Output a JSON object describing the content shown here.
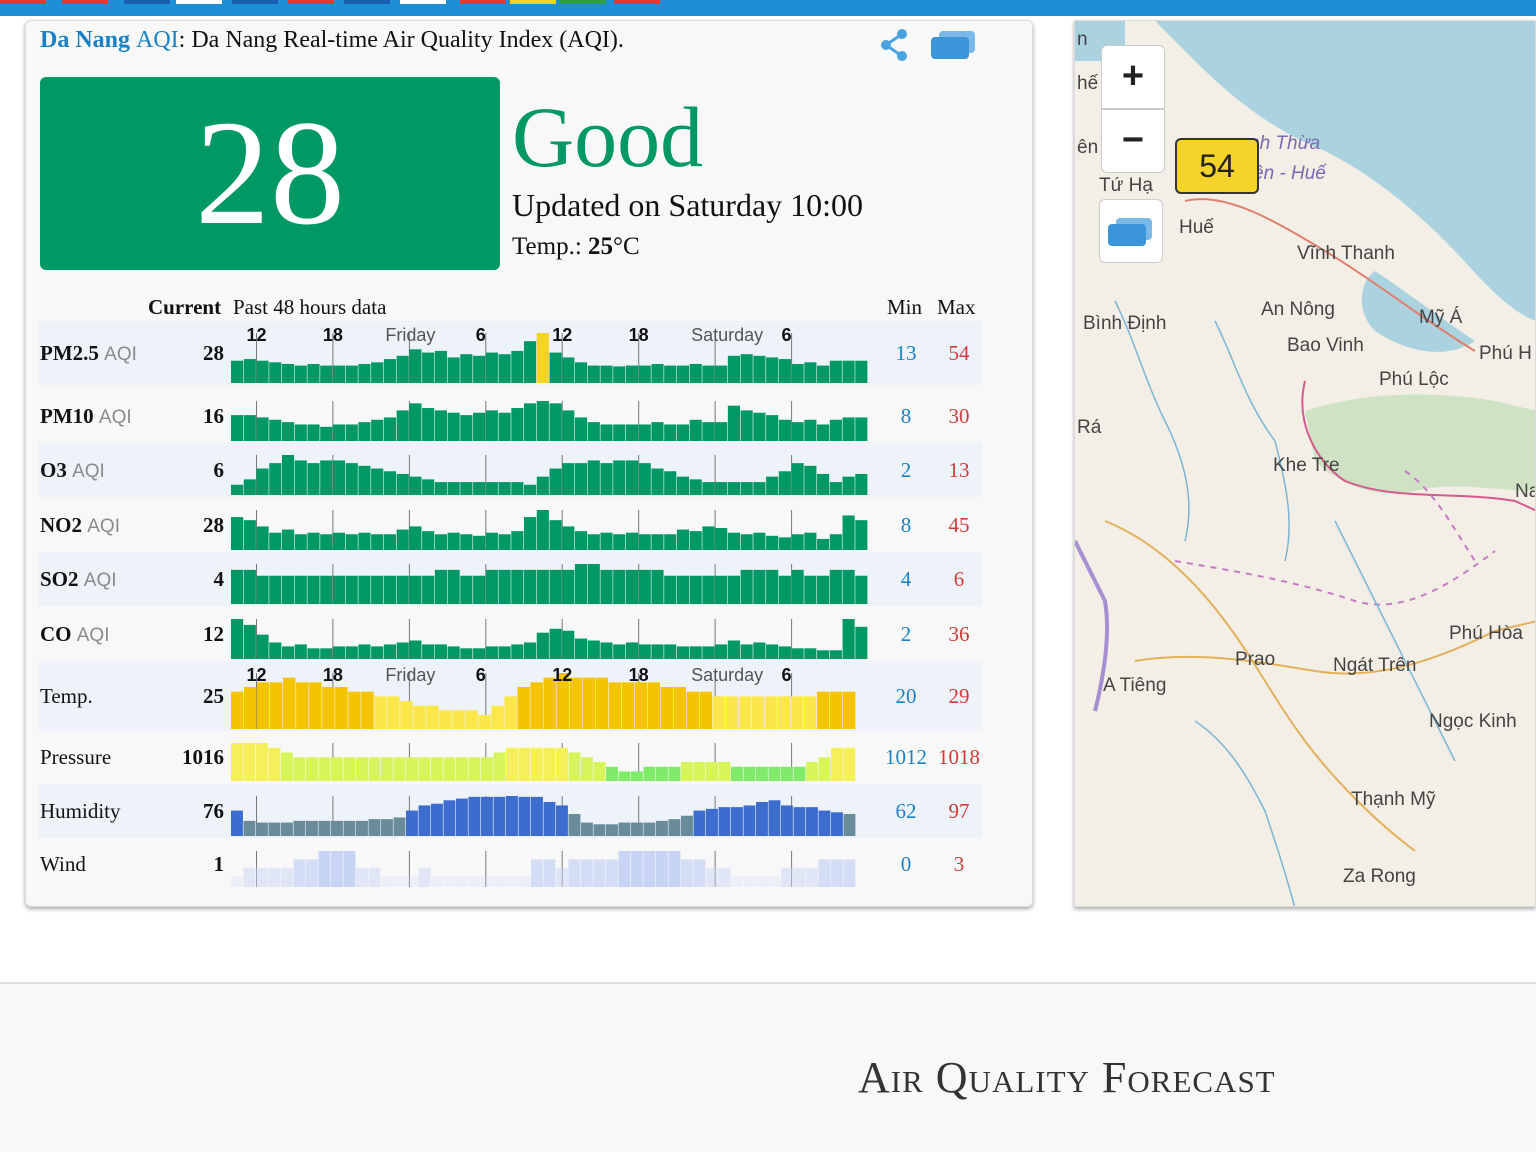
{
  "headline": {
    "city_link_bold": "Da Nang",
    "city_link_thin": "AQI",
    "description": ": Da Nang Real-time Air Quality Index (AQI)."
  },
  "aqi": {
    "value": "28",
    "level": "Good",
    "updated": "Updated on Saturday 10:00",
    "temp_label": "Temp.: ",
    "temp_value": "25",
    "temp_unit": "°C",
    "color": "#009966"
  },
  "table": {
    "current_label": "Current",
    "past_label": "Past 48 hours data",
    "min_label": "Min",
    "max_label": "Max",
    "axis_labels": [
      {
        "text": "12",
        "kind": "hr",
        "hour_index": 2
      },
      {
        "text": "18",
        "kind": "hr",
        "hour_index": 8
      },
      {
        "text": "Friday",
        "kind": "day",
        "hour_index": 14
      },
      {
        "text": "6",
        "kind": "hr",
        "hour_index": 20
      },
      {
        "text": "12",
        "kind": "hr",
        "hour_index": 26
      },
      {
        "text": "18",
        "kind": "hr",
        "hour_index": 32
      },
      {
        "text": "Saturday",
        "kind": "day",
        "hour_index": 38
      },
      {
        "text": "6",
        "kind": "hr",
        "hour_index": 44
      }
    ],
    "rows": [
      {
        "id": "pm25",
        "name": "PM2.5",
        "suffix": "AQI",
        "current": "28",
        "min": "13",
        "max": "54",
        "color": "#009966",
        "highlight_index": 24,
        "highlight_color": "#f5d328",
        "values": [
          20,
          22,
          20,
          18,
          16,
          14,
          16,
          14,
          14,
          14,
          16,
          18,
          22,
          26,
          34,
          30,
          32,
          24,
          28,
          26,
          30,
          28,
          32,
          44,
          54,
          30,
          24,
          18,
          14,
          14,
          13,
          14,
          14,
          16,
          14,
          14,
          16,
          14,
          14,
          26,
          28,
          26,
          24,
          22,
          16,
          18,
          14,
          20,
          20,
          20
        ]
      },
      {
        "id": "pm10",
        "name": "PM10",
        "suffix": "AQI",
        "current": "16",
        "min": "8",
        "max": "30",
        "color": "#009966",
        "values": [
          18,
          18,
          16,
          14,
          12,
          10,
          10,
          8,
          10,
          10,
          12,
          14,
          16,
          22,
          28,
          24,
          22,
          20,
          18,
          20,
          22,
          20,
          24,
          28,
          30,
          28,
          22,
          16,
          12,
          10,
          10,
          10,
          10,
          12,
          10,
          10,
          14,
          12,
          12,
          26,
          22,
          20,
          18,
          14,
          12,
          14,
          10,
          14,
          16,
          16
        ]
      },
      {
        "id": "o3",
        "name": "O3",
        "suffix": "AQI",
        "current": "6",
        "min": "2",
        "max": "13",
        "color": "#009966",
        "values": [
          2,
          4,
          8,
          10,
          13,
          11,
          10,
          11,
          11,
          10,
          9,
          8,
          7,
          6,
          5,
          4,
          3,
          3,
          3,
          3,
          3,
          3,
          3,
          2,
          5,
          8,
          10,
          10,
          11,
          10,
          11,
          11,
          10,
          8,
          7,
          5,
          4,
          3,
          3,
          3,
          3,
          3,
          5,
          7,
          10,
          9,
          6,
          3,
          5,
          6
        ]
      },
      {
        "id": "no2",
        "name": "NO2",
        "suffix": "AQI",
        "current": "28",
        "min": "8",
        "max": "45",
        "color": "#009966",
        "values": [
          36,
          32,
          24,
          16,
          20,
          14,
          16,
          14,
          16,
          14,
          16,
          14,
          14,
          20,
          24,
          18,
          14,
          16,
          14,
          12,
          16,
          14,
          18,
          36,
          45,
          32,
          24,
          18,
          14,
          16,
          14,
          16,
          14,
          14,
          14,
          20,
          18,
          24,
          22,
          16,
          14,
          16,
          12,
          10,
          14,
          16,
          8,
          14,
          38,
          32
        ]
      },
      {
        "id": "so2",
        "name": "SO2",
        "suffix": "AQI",
        "current": "4",
        "min": "4",
        "max": "6",
        "color": "#009966",
        "values": [
          5,
          5,
          4,
          4,
          4,
          4,
          4,
          4,
          4,
          4,
          4,
          4,
          4,
          4,
          4,
          4,
          5,
          5,
          4,
          4,
          5,
          5,
          5,
          5,
          5,
          5,
          5,
          6,
          6,
          5,
          5,
          5,
          5,
          5,
          4,
          4,
          4,
          4,
          4,
          4,
          5,
          5,
          5,
          4,
          5,
          4,
          4,
          5,
          5,
          4
        ]
      },
      {
        "id": "co",
        "name": "CO",
        "suffix": "AQI",
        "current": "12",
        "min": "2",
        "max": "36",
        "color": "#009966",
        "values": [
          36,
          30,
          20,
          12,
          8,
          10,
          6,
          6,
          8,
          8,
          10,
          8,
          10,
          12,
          14,
          10,
          10,
          8,
          6,
          6,
          8,
          8,
          10,
          12,
          22,
          26,
          24,
          16,
          14,
          12,
          10,
          12,
          10,
          10,
          10,
          8,
          8,
          8,
          10,
          14,
          10,
          12,
          10,
          8,
          6,
          6,
          4,
          4,
          36,
          28
        ]
      },
      {
        "id": "temp",
        "name": "Temp.",
        "suffix": "",
        "current": "25",
        "min": "20",
        "max": "29",
        "color": "#f5c400",
        "color_low": "#fbe74a",
        "scale_min": 20,
        "scale_max": 29,
        "values": [
          25,
          26,
          27,
          27,
          28,
          27,
          27,
          26,
          26,
          25,
          25,
          24,
          24,
          23,
          22,
          22,
          21,
          21,
          21,
          20,
          22,
          24,
          26,
          27,
          28,
          29,
          28,
          28,
          28,
          27,
          27,
          27,
          27,
          26,
          26,
          25,
          25,
          24,
          24,
          24,
          24,
          24,
          24,
          24,
          24,
          25,
          25,
          25
        ]
      },
      {
        "id": "pressure",
        "name": "Pressure",
        "suffix": "",
        "current": "1016",
        "min": "1012",
        "max": "1018",
        "color": "#d6f558",
        "color_low": "#80ea6a",
        "color_high": "#f5f05a",
        "scale_min": 1012,
        "scale_max": 1018,
        "values": [
          1018,
          1018,
          1018,
          1017,
          1016,
          1015,
          1015,
          1015,
          1015,
          1015,
          1015,
          1015,
          1015,
          1015,
          1015,
          1015,
          1015,
          1015,
          1015,
          1015,
          1015,
          1016,
          1017,
          1017,
          1017,
          1017,
          1017,
          1016,
          1015,
          1014,
          1013,
          1012,
          1012,
          1013,
          1013,
          1013,
          1014,
          1014,
          1014,
          1014,
          1013,
          1013,
          1013,
          1013,
          1013,
          1013,
          1014,
          1015,
          1017,
          1017
        ]
      },
      {
        "id": "humidity",
        "name": "Humidity",
        "suffix": "",
        "current": "76",
        "min": "62",
        "max": "97",
        "color": "#3d6ccf",
        "color_low": "#6a8c9a",
        "scale_min": 62,
        "scale_max": 97,
        "values": [
          80,
          68,
          66,
          66,
          66,
          68,
          68,
          68,
          68,
          68,
          68,
          70,
          70,
          72,
          80,
          86,
          88,
          92,
          94,
          96,
          96,
          96,
          97,
          96,
          96,
          90,
          86,
          76,
          66,
          64,
          64,
          66,
          66,
          66,
          68,
          70,
          74,
          80,
          82,
          84,
          84,
          86,
          90,
          92,
          86,
          84,
          84,
          80,
          78,
          76
        ]
      },
      {
        "id": "wind",
        "name": "Wind",
        "suffix": "",
        "current": "1",
        "min": "0",
        "max": "3",
        "color": "#c7d4f4",
        "scale_min": 0,
        "scale_max": 3,
        "values": [
          0,
          1,
          1,
          1,
          1,
          2,
          2,
          3,
          3,
          3,
          1,
          1,
          0,
          0,
          0,
          1,
          0,
          0,
          0,
          0,
          0,
          0,
          0,
          0,
          2,
          2,
          1,
          2,
          2,
          2,
          2,
          3,
          3,
          3,
          3,
          3,
          2,
          2,
          1,
          1,
          0,
          0,
          0,
          0,
          1,
          1,
          1,
          2,
          2,
          2
        ]
      }
    ]
  },
  "map": {
    "zoom_in": "+",
    "zoom_out": "−",
    "station_aqi": "54",
    "places": [
      {
        "id": "n-top",
        "text": "n",
        "italic": false,
        "col": 2,
        "row": 8
      },
      {
        "id": "nhe",
        "text": "hế",
        "italic": false,
        "col": 2,
        "row": 52
      },
      {
        "id": "en",
        "text": "ên",
        "italic": false,
        "col": 2,
        "row": 116
      },
      {
        "id": "tu-ha",
        "text": "Tứ Hạ",
        "italic": false,
        "col": 24,
        "row": 154
      },
      {
        "id": "hue",
        "text": "Huế",
        "italic": false,
        "col": 104,
        "row": 196
      },
      {
        "id": "thua-thien-1",
        "text": "nh Thừa",
        "italic": true,
        "col": 174,
        "row": 112
      },
      {
        "id": "thua-thien-2",
        "text": "ên - Huế",
        "italic": true,
        "col": 178,
        "row": 142
      },
      {
        "id": "vinh-thanh",
        "text": "Vĩnh Thanh",
        "italic": false,
        "col": 222,
        "row": 222
      },
      {
        "id": "binh-dinh",
        "text": "Bình Định",
        "italic": false,
        "col": 8,
        "row": 292
      },
      {
        "id": "an-nong",
        "text": "An Nông",
        "italic": false,
        "col": 186,
        "row": 278
      },
      {
        "id": "my-a",
        "text": "Mỹ Á",
        "italic": false,
        "col": 344,
        "row": 286
      },
      {
        "id": "bao-vinh",
        "text": "Bao Vinh",
        "italic": false,
        "col": 212,
        "row": 314
      },
      {
        "id": "phu-h",
        "text": "Phú H",
        "italic": false,
        "col": 404,
        "row": 322
      },
      {
        "id": "phu-loc",
        "text": "Phú Lộc",
        "italic": false,
        "col": 304,
        "row": 348
      },
      {
        "id": "ra",
        "text": "Rá",
        "italic": false,
        "col": 2,
        "row": 396
      },
      {
        "id": "khe-tre",
        "text": "Khe Tre",
        "italic": false,
        "col": 198,
        "row": 434
      },
      {
        "id": "na",
        "text": "Na",
        "italic": false,
        "col": 440,
        "row": 460
      },
      {
        "id": "phu-hoa",
        "text": "Phú Hòa",
        "italic": false,
        "col": 374,
        "row": 602
      },
      {
        "id": "prao",
        "text": "Prao",
        "italic": false,
        "col": 160,
        "row": 628
      },
      {
        "id": "ngat-tren",
        "text": "Ngát Trên",
        "italic": false,
        "col": 258,
        "row": 634
      },
      {
        "id": "a-tieng",
        "text": "A Tiêng",
        "italic": false,
        "col": 28,
        "row": 654
      },
      {
        "id": "ngoc-kinh",
        "text": "Ngọc Kinh",
        "italic": false,
        "col": 354,
        "row": 690
      },
      {
        "id": "thanh-my",
        "text": "Thạnh Mỹ",
        "italic": false,
        "col": 276,
        "row": 768
      },
      {
        "id": "za-rong",
        "text": "Za Rong",
        "italic": false,
        "col": 268,
        "row": 845
      }
    ]
  },
  "footer": {
    "forecast_title": "Air Quality Forecast"
  }
}
